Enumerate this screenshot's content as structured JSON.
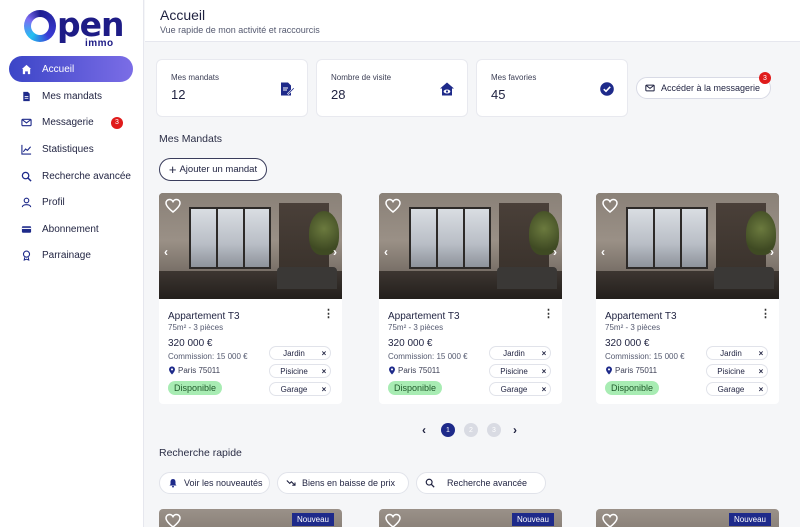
{
  "brand": {
    "logo_o": "o",
    "logo_pen": "pen",
    "logo_immo": "immo"
  },
  "sidebar": {
    "items": [
      {
        "label": "Accueil",
        "icon": "home-icon",
        "active": true
      },
      {
        "label": "Mes mandats",
        "icon": "document-icon"
      },
      {
        "label": "Messagerie",
        "icon": "mail-icon",
        "badge": "3"
      },
      {
        "label": "Statistiques",
        "icon": "chart-icon"
      },
      {
        "label": "Recherche avancée",
        "icon": "search-icon"
      },
      {
        "label": "Profil",
        "icon": "user-icon"
      },
      {
        "label": "Abonnement",
        "icon": "credit-card-icon"
      },
      {
        "label": "Parrainage",
        "icon": "sponsorship-icon"
      }
    ]
  },
  "header": {
    "title": "Accueil",
    "subtitle": "Vue rapide de mon activité et raccourcis"
  },
  "stats": [
    {
      "label": "Mes mandats",
      "value": "12",
      "icon": "signed-document-icon"
    },
    {
      "label": "Nombre de visite",
      "value": "28",
      "icon": "house-eye-icon"
    },
    {
      "label": "Mes favories",
      "value": "45",
      "icon": "check-circle-icon"
    }
  ],
  "messaging": {
    "label": "Accéder à la messagerie",
    "badge": "3",
    "icon": "mail-icon"
  },
  "mandats": {
    "title": "Mes Mandats",
    "add_label": "Ajouter un mandat",
    "add_plus": "+",
    "cards": [
      {
        "name": "Appartement T3",
        "surface": "75m² - 3 pièces",
        "price": "320 000 €",
        "commission": "Commission: 15 000 €",
        "location": "Paris 75011",
        "status": "Disponible",
        "tags": [
          "Jardin",
          "Pisicine",
          "Garage"
        ]
      },
      {
        "name": "Appartement T3",
        "surface": "75m² - 3 pièces",
        "price": "320 000 €",
        "commission": "Commission: 15 000 €",
        "location": "Paris 75011",
        "status": "Disponible",
        "tags": [
          "Jardin",
          "Pisicine",
          "Garage"
        ]
      },
      {
        "name": "Appartement T3",
        "surface": "75m² - 3 pièces",
        "price": "320 000 €",
        "commission": "Commission: 15 000 €",
        "location": "Paris 75011",
        "status": "Disponible",
        "tags": [
          "Jardin",
          "Pisicine",
          "Garage"
        ]
      }
    ],
    "tag_remove": "×",
    "menu_glyph": "⋮",
    "photo_prev": "‹",
    "photo_next": "›"
  },
  "pagination": {
    "pages": [
      "1",
      "2",
      "3"
    ],
    "current": "1",
    "prev": "‹",
    "next": "›"
  },
  "quick_search": {
    "title": "Recherche rapide",
    "buttons": [
      {
        "label": "Voir les nouveautés",
        "icon": "bell-icon"
      },
      {
        "label": "Biens en baisse de prix",
        "icon": "trending-down-icon"
      },
      {
        "label": "Recherche avancée",
        "icon": "search-icon"
      }
    ],
    "new_badge": "Nouveau"
  },
  "colors": {
    "primary": "#1e2a8a",
    "accent_gradient_start": "#3b45c7",
    "accent_gradient_end": "#7b6de6",
    "badge_red": "#e01b1b",
    "status_green": "#a8ecb3"
  }
}
